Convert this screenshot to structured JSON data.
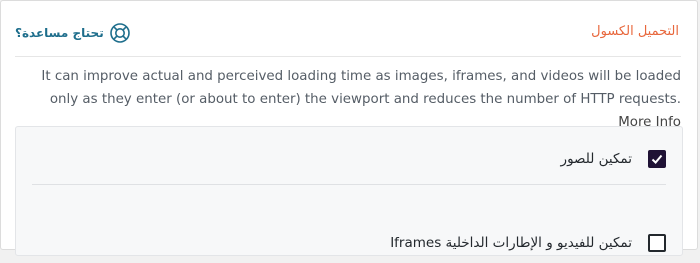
{
  "section": {
    "title": "التحميل الكسول",
    "help_label": "تحتاج مساعدة؟",
    "help_icon": "lifebuoy-icon",
    "accent_color": "#e8673c",
    "help_color": "#1e6e8c"
  },
  "description": {
    "text": "It can improve actual and perceived loading time as images, iframes, and videos will be loaded only as they enter (or about to enter) the viewport and reduces the number of HTTP requests.",
    "more_info_label": "More Info"
  },
  "options": [
    {
      "label": "تمكين للصور",
      "checked": true
    },
    {
      "label": "تمكين للفيديو و الإطارات الداخلية Iframes",
      "checked": false
    }
  ]
}
